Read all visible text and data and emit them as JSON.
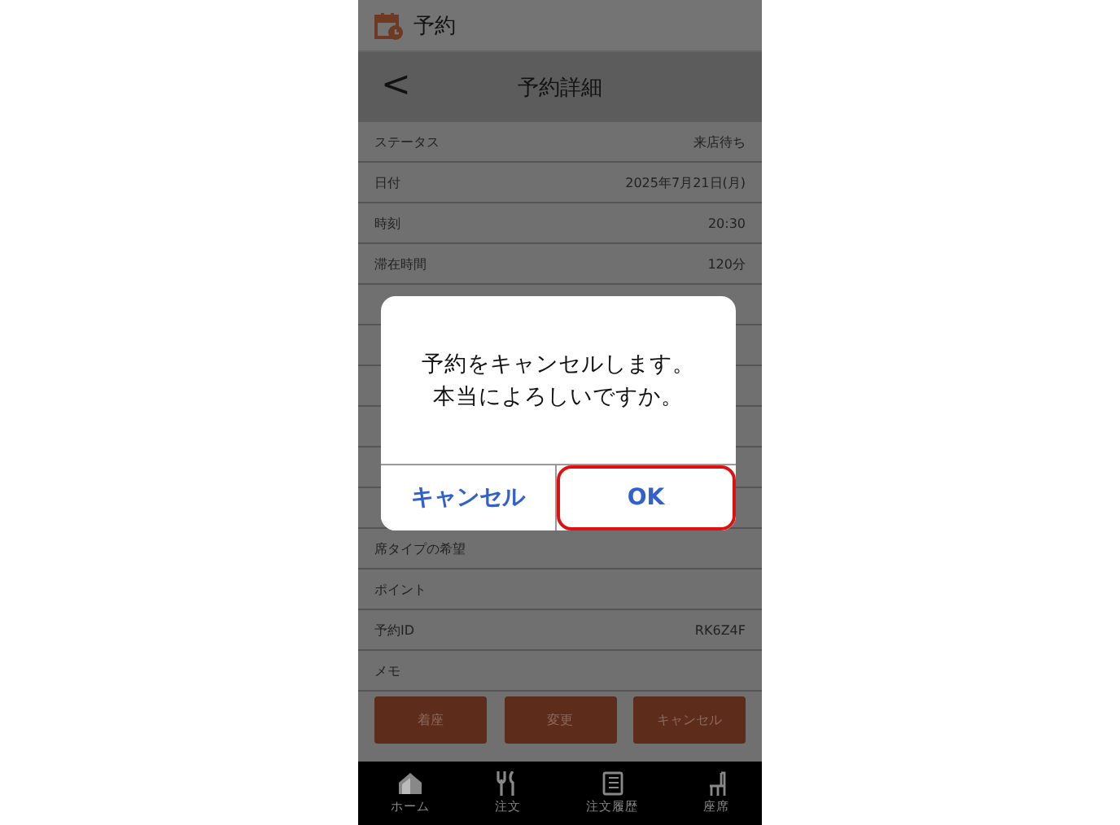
{
  "app_bar": {
    "title": "予約"
  },
  "header": {
    "back": "<",
    "title": "予約詳細"
  },
  "rows": [
    {
      "label": "ステータス",
      "value": "来店待ち"
    },
    {
      "label": "日付",
      "value": "2025年7月21日(月)"
    },
    {
      "label": "時刻",
      "value": "20:30"
    },
    {
      "label": "滞在時間",
      "value": "120分"
    },
    {
      "label": "席タイプの希望"
    },
    {
      "label": "ポイント"
    },
    {
      "label": "予約ID",
      "value": "RK6Z4F"
    },
    {
      "label": "メモ"
    }
  ],
  "actions": [
    "着座",
    "変更",
    "キャンセル"
  ],
  "nav": [
    {
      "kind": "home",
      "label": "ホーム"
    },
    {
      "kind": "order",
      "label": "注文"
    },
    {
      "kind": "history",
      "label": "注文履歴"
    },
    {
      "kind": "seat",
      "label": "座席"
    }
  ],
  "dialog": {
    "message": [
      "予約をキャンセルします。",
      "本当によろしいですか。"
    ],
    "buttons": [
      {
        "label": "キャンセル",
        "selected": false
      },
      {
        "label": "OK",
        "selected": true
      }
    ]
  }
}
